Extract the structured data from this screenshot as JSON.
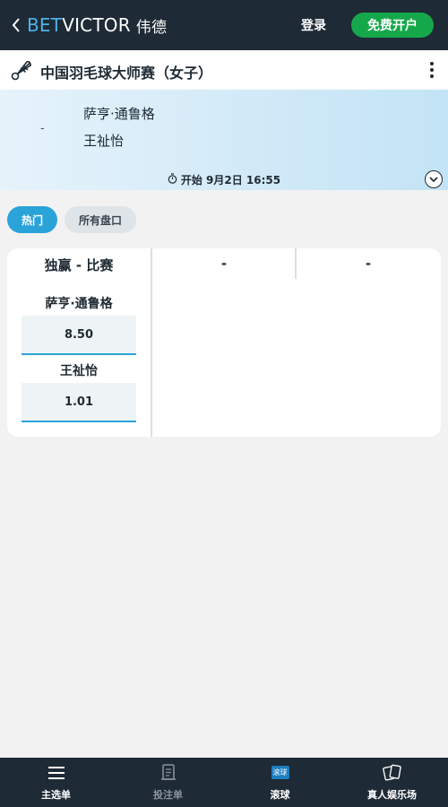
{
  "header": {
    "logo_bet": "BET",
    "logo_victor": "VICTOR",
    "logo_cn": "伟德",
    "login_label": "登录",
    "open_account_label": "免费开户"
  },
  "event": {
    "title": "中国羽毛球大师赛（女子）",
    "icon": "shuttlecock-icon"
  },
  "scoreboard": {
    "score": "-",
    "player1": "萨亨·通鲁格",
    "player2": "王祉怡",
    "start_text": "开始 9月2日 16:55"
  },
  "tabs": [
    {
      "label": "热门",
      "active": true
    },
    {
      "label": "所有盘口",
      "active": false
    }
  ],
  "market": {
    "title": "独赢 - 比赛",
    "col2": "-",
    "col3": "-",
    "selections": [
      {
        "name": "萨亨·通鲁格",
        "odds": "8.50"
      },
      {
        "name": "王祉怡",
        "odds": "1.01"
      }
    ]
  },
  "bottom_nav": [
    {
      "label": "主选单",
      "icon": "menu-icon"
    },
    {
      "label": "投注单",
      "icon": "betslip-icon"
    },
    {
      "label": "滚球",
      "icon": "live-icon",
      "badge": "滚球"
    },
    {
      "label": "真人娱乐场",
      "icon": "cards-icon"
    }
  ],
  "colors": {
    "topbar": "#1e2a35",
    "accent_blue": "#2aa3d8",
    "green": "#15a84a"
  }
}
